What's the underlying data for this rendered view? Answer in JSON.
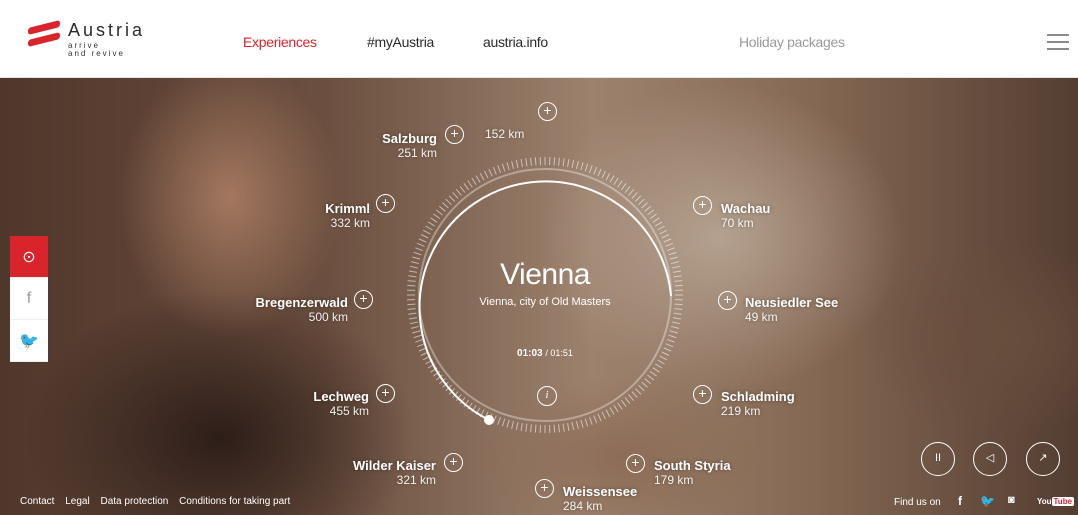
{
  "brand": {
    "word": "Austria",
    "tag1": "arrive",
    "tag2": "and revive",
    "accent": "#d9242b"
  },
  "nav": [
    {
      "label": "Experiences",
      "active": true
    },
    {
      "label": "#myAustria"
    },
    {
      "label": "austria.info"
    },
    {
      "label": "Holiday packages"
    }
  ],
  "menu_icon": "hamburger-menu-icon",
  "sidebar": [
    {
      "icon": "location-pin-icon",
      "glyph": "⊙"
    },
    {
      "icon": "facebook-icon",
      "glyph": "f"
    },
    {
      "icon": "twitter-icon",
      "glyph": "🐦"
    }
  ],
  "center": {
    "city": "Vienna",
    "subtitle": "Vienna, city of Old Masters",
    "time_current": "01:03",
    "time_total": "/ 01:51",
    "info": "i"
  },
  "destinations": [
    {
      "name": "Salzburg",
      "km": "251 km"
    },
    {
      "name": "",
      "km": "152 km"
    },
    {
      "name": "Krimml",
      "km": "332 km"
    },
    {
      "name": "Wachau",
      "km": "70 km"
    },
    {
      "name": "Bregenzerwald",
      "km": "500 km"
    },
    {
      "name": "Neusiedler See",
      "km": "49 km"
    },
    {
      "name": "Lechweg",
      "km": "455 km"
    },
    {
      "name": "Schladming",
      "km": "219 km"
    },
    {
      "name": "Wilder Kaiser",
      "km": "321 km"
    },
    {
      "name": "South Styria",
      "km": "179 km"
    },
    {
      "name": "Weissensee",
      "km": "284 km"
    }
  ],
  "controls": {
    "pause": "II",
    "sound": "◁",
    "share": "↗"
  },
  "footer": {
    "links": [
      "Contact",
      "Legal",
      "Data protection",
      "Conditions for taking part"
    ],
    "findus": "Find us on",
    "youtube_a": "You",
    "youtube_b": "Tube"
  }
}
